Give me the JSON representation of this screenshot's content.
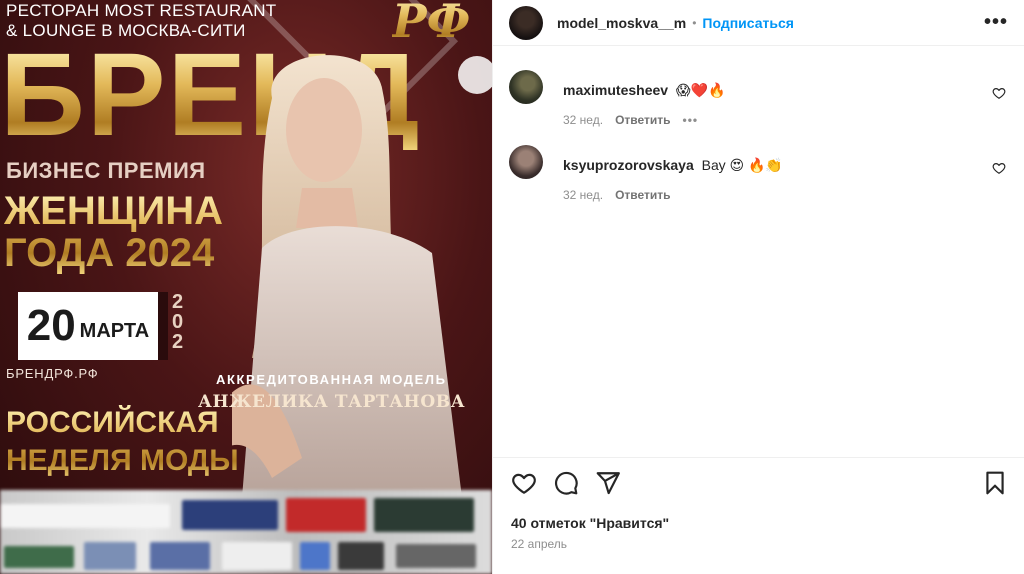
{
  "poster": {
    "venue_line1": "РЕСТОРАН MOST RESTAURANT",
    "venue_line2": "& LOUNGE В МОСКВА-СИТИ",
    "rf": "РФ",
    "brand": "БРЕНД",
    "business_award": "БИЗНЕС ПРЕМИЯ",
    "woman_line1": "ЖЕНЩИНА",
    "woman_line2": "ГОДА 2024",
    "day": "20",
    "month": "МАРТА",
    "year_partial": "202",
    "website": "БРЕНДРФ.РФ",
    "accredited": "АККРЕДИТОВАННАЯ МОДЕЛЬ",
    "model_name": "АНЖЕЛИКА ТАРТАНОВА",
    "week_line1": "РОССИЙСКАЯ",
    "week_line2": "НЕДЕЛЯ МОДЫ"
  },
  "header": {
    "username": "model_moskva__m",
    "separator": "•",
    "follow_label": "Подписаться",
    "more_label": "•••"
  },
  "comments": [
    {
      "username": "maximutesheev",
      "text": "😱❤️🔥",
      "age": "32 нед.",
      "reply_label": "Ответить",
      "more_label": "•••"
    },
    {
      "username": "ksyuprozorovskaya",
      "text": "Вау 😍 🔥👏",
      "age": "32 нед.",
      "reply_label": "Ответить"
    }
  ],
  "footer": {
    "likes_text": "40 отметок \"Нравится\"",
    "date_text": "22 апрель"
  },
  "colors": {
    "accent": "#0095f6",
    "poster_bg": "#4a1516",
    "gold": "#e3b95a"
  },
  "icons": [
    "heart-icon",
    "comment-icon",
    "share-icon",
    "bookmark-icon",
    "more-icon"
  ]
}
